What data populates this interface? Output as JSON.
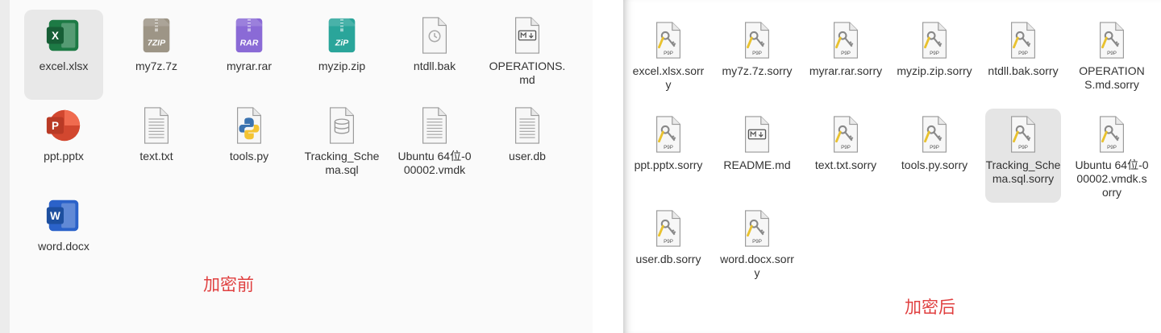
{
  "left": {
    "files": [
      {
        "name": "excel.xlsx",
        "icon": "excel-icon",
        "selected": true
      },
      {
        "name": "my7z.7z",
        "icon": "7z-archive-icon"
      },
      {
        "name": "myrar.rar",
        "icon": "rar-archive-icon"
      },
      {
        "name": "myzip.zip",
        "icon": "zip-archive-icon"
      },
      {
        "name": "ntdll.bak",
        "icon": "backup-file-icon"
      },
      {
        "name": "OPERATIONS.md",
        "icon": "markdown-file-icon"
      },
      {
        "name": "ppt.pptx",
        "icon": "powerpoint-icon"
      },
      {
        "name": "text.txt",
        "icon": "text-file-icon"
      },
      {
        "name": "tools.py",
        "icon": "python-file-icon"
      },
      {
        "name": "Tracking_Schema.sql",
        "icon": "database-file-icon"
      },
      {
        "name": "Ubuntu 64位-000002.vmdk",
        "icon": "text-file-icon"
      },
      {
        "name": "user.db",
        "icon": "text-file-icon"
      },
      {
        "name": "word.docx",
        "icon": "word-icon"
      }
    ],
    "caption": "加密前"
  },
  "right": {
    "files": [
      {
        "name": "excel.xlsx.sorry",
        "icon": "p9p-key-file-icon"
      },
      {
        "name": "my7z.7z.sorry",
        "icon": "p9p-key-file-icon"
      },
      {
        "name": "myrar.rar.sorry",
        "icon": "p9p-key-file-icon"
      },
      {
        "name": "myzip.zip.sorry",
        "icon": "p9p-key-file-icon"
      },
      {
        "name": "ntdll.bak.sorry",
        "icon": "p9p-key-file-icon"
      },
      {
        "name": "OPERATIONS.md.sorry",
        "icon": "p9p-key-file-icon"
      },
      {
        "name": "ppt.pptx.sorry",
        "icon": "p9p-key-file-icon"
      },
      {
        "name": "README.md",
        "icon": "markdown-file-icon"
      },
      {
        "name": "text.txt.sorry",
        "icon": "p9p-key-file-icon"
      },
      {
        "name": "tools.py.sorry",
        "icon": "p9p-key-file-icon"
      },
      {
        "name": "Tracking_Schema.sql.sorry",
        "icon": "p9p-key-file-icon",
        "selected": true
      },
      {
        "name": "Ubuntu 64位-000002.vmdk.sorry",
        "icon": "p9p-key-file-icon"
      },
      {
        "name": "user.db.sorry",
        "icon": "p9p-key-file-icon"
      },
      {
        "name": "word.docx.sorry",
        "icon": "p9p-key-file-icon"
      }
    ],
    "caption": "加密后",
    "p9p_badge": "P9P"
  },
  "icon_labels": {
    "seven_zip": "7ZIP",
    "rar": "RAR",
    "zip": "ZiP"
  },
  "colors": {
    "caption": "#e04040",
    "excel": "#1d7a45",
    "powerpoint": "#d2472f",
    "word": "#2b62c9",
    "zip": "#2aa59a",
    "rar": "#8a6ad6",
    "seven_zip": "#9d9586"
  }
}
